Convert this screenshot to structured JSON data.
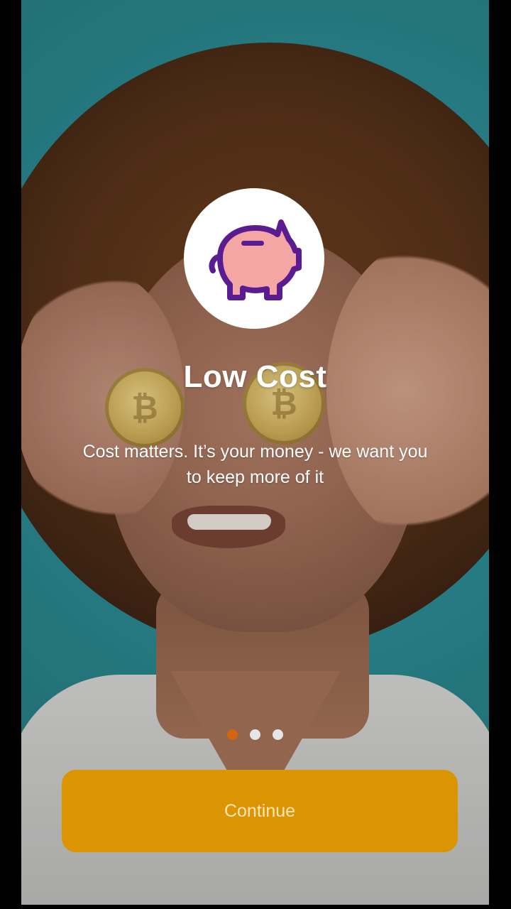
{
  "onboarding": {
    "title": "Low Cost",
    "description": "Cost matters. It’s your money - we want you to keep more of it",
    "icon": "piggy-bank-icon",
    "continue_label": "Continue",
    "pagination": {
      "total": 3,
      "active_index": 0
    }
  },
  "colors": {
    "accent": "#dc9502",
    "active_dot": "#d7650f",
    "inactive_dot": "#e6e6e6",
    "piggy_fill": "#f4a6a4",
    "piggy_stroke": "#5b1c91",
    "background_teal": "#2e8f97"
  }
}
